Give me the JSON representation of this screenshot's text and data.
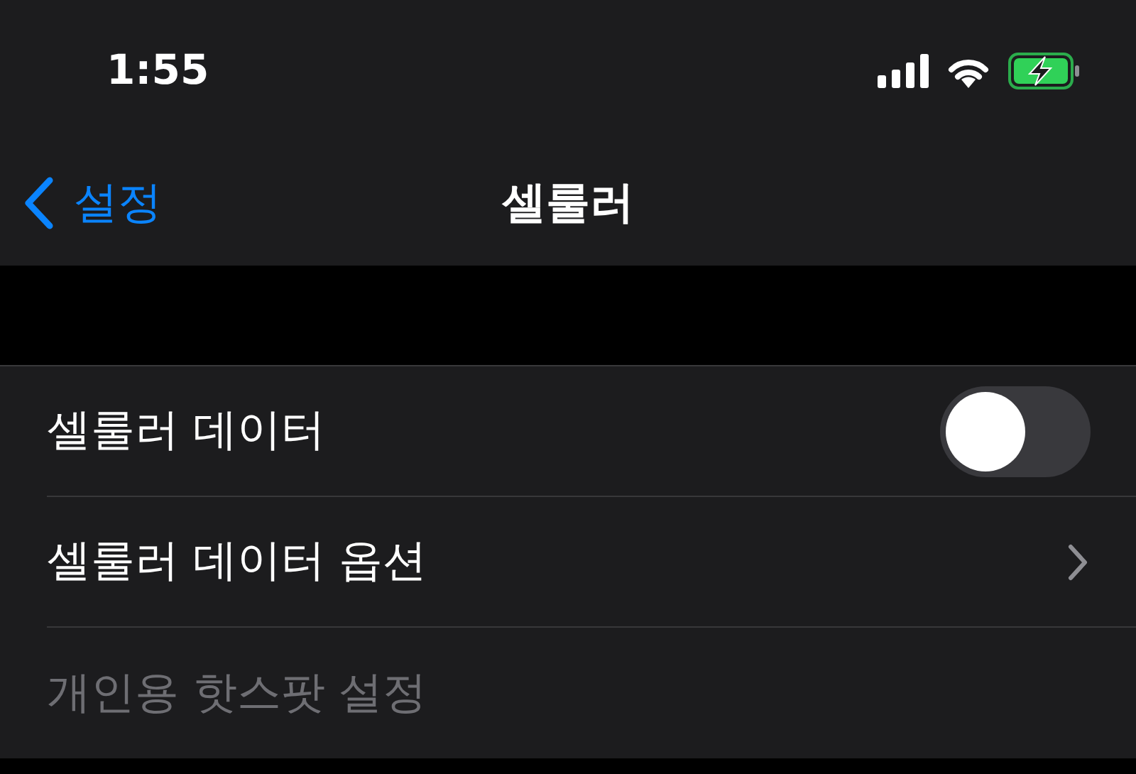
{
  "status_bar": {
    "time": "1:55",
    "battery_charging": true
  },
  "nav": {
    "back_label": "설정",
    "title": "셀룰러"
  },
  "rows": [
    {
      "kind": "toggle",
      "label": "셀룰러 데이터",
      "on": false,
      "disabled": false
    },
    {
      "kind": "link",
      "label": "셀룰러 데이터 옵션",
      "disabled": false
    },
    {
      "kind": "text",
      "label": "개인용 핫스팟 설정",
      "disabled": true
    }
  ]
}
